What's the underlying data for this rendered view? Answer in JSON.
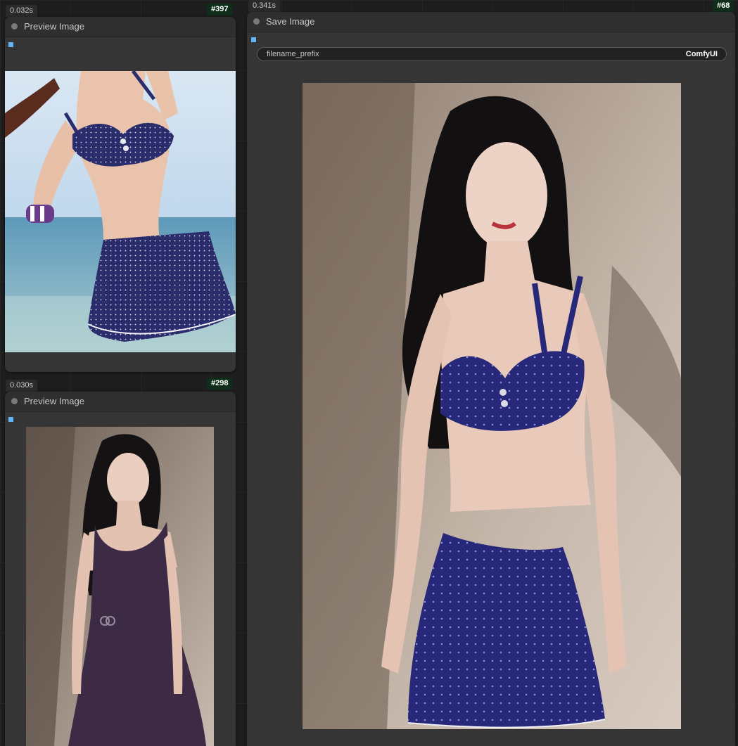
{
  "nodes": {
    "preview1": {
      "time": "0.032s",
      "id": "#397",
      "title": "Preview Image",
      "image_icon": "beach-polka-dot-bikini-image"
    },
    "preview2": {
      "time": "0.030s",
      "id": "#298",
      "title": "Preview Image",
      "image_icon": "woman-purple-dress-image"
    },
    "save": {
      "time": "0.341s",
      "id": "#68",
      "title": "Save Image",
      "widget": {
        "label": "filename_prefix",
        "value": "ComfyUI"
      },
      "image_icon": "woman-navy-polka-dot-bikini-image"
    }
  },
  "colors": {
    "canvas": "#1d1d1d",
    "node_body": "#353535",
    "node_header": "#2f2f2f",
    "slot": "#64b5f6",
    "id_badge": "#0f2e1a"
  }
}
